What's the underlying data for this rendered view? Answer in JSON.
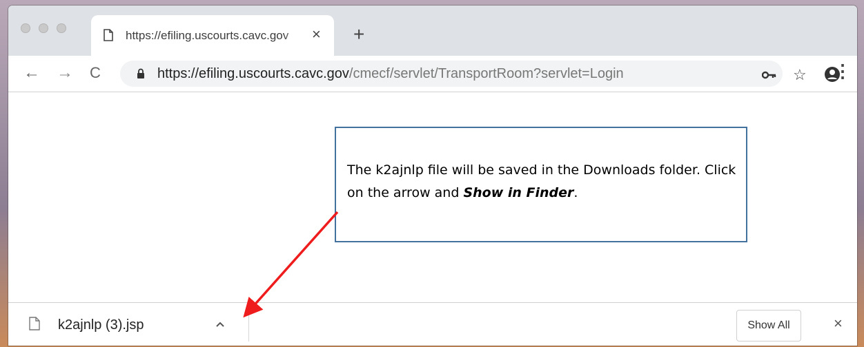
{
  "tab": {
    "title": "https://efiling.uscourts.cavc.gov",
    "close_glyph": "×",
    "new_tab_glyph": "+"
  },
  "nav": {
    "back_glyph": "←",
    "forward_glyph": "→",
    "reload_glyph": "C"
  },
  "omnibox": {
    "url_host": "https://efiling.uscourts.cavc.gov",
    "url_path": "/cmecf/servlet/TransportRoom?servlet=Login"
  },
  "toolbar_icons": {
    "key": "key-icon",
    "star": "star-icon",
    "account": "account-icon",
    "menu": "menu-icon"
  },
  "callout": {
    "text_before": "The k2ajnlp file will be saved in the Downloads folder. Click on the arrow and ",
    "emphasis": "Show in Finder",
    "text_after": "."
  },
  "downloads": {
    "file_name": "k2ajnlp (3).jsp",
    "chevron_glyph": "^",
    "show_all_label": "Show All",
    "close_glyph": "×"
  },
  "colors": {
    "arrow": "#ee1c1c",
    "callout_border": "#41719c"
  }
}
